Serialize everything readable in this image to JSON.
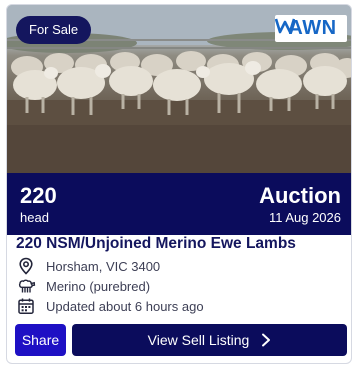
{
  "listing": {
    "badge": "For Sale",
    "logo_text": "AWN",
    "head_count": "220",
    "head_label": "head",
    "sale_type": "Auction",
    "sale_date": "11 Aug 2026",
    "title": "220 NSM/Unjoined Merino Ewe Lambs",
    "location": "Horsham, VIC 3400",
    "breed": "Merino (purebred)",
    "updated": "Updated about 6 hours ago"
  },
  "actions": {
    "share_label": "Share",
    "view_label": "View Sell Listing"
  },
  "icons": {
    "location": "map-pin-icon",
    "breed": "sheep-icon",
    "updated": "calendar-icon",
    "view": "chevron-right-icon"
  },
  "colors": {
    "navy": "#0b0c5c",
    "share_blue": "#1e10c4",
    "logo_blue": "#1667c6"
  }
}
